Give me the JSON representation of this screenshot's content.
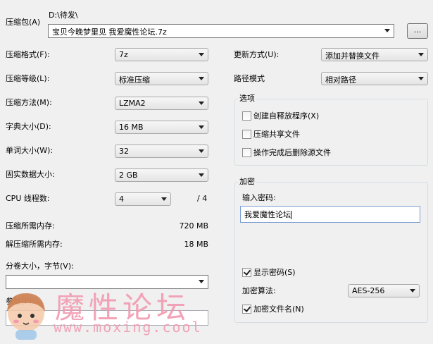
{
  "archive": {
    "label": "压缩包(A)",
    "path": "D:\\待发\\",
    "filename": "宝贝今晚梦里见 我爱魔性论坛.7z",
    "browse_label": "..."
  },
  "left": {
    "format": {
      "label": "压缩格式(F):",
      "value": "7z"
    },
    "level": {
      "label": "压缩等级(L):",
      "value": "标准压缩"
    },
    "method": {
      "label": "压缩方法(M):",
      "value": "LZMA2"
    },
    "dict": {
      "label": "字典大小(D):",
      "value": "16 MB"
    },
    "word": {
      "label": "单词大小(W):",
      "value": "32"
    },
    "solid": {
      "label": "固实数据大小:",
      "value": "2 GB"
    },
    "threads": {
      "label": "CPU 线程数:",
      "value": "4",
      "max": "/ 4"
    },
    "mem_compress": {
      "label": "压缩所需内存:",
      "value": "720 MB"
    },
    "mem_decompress": {
      "label": "解压缩所需内存:",
      "value": "18 MB"
    },
    "split": {
      "label": "分卷大小，字节(V):",
      "value": ""
    },
    "params": {
      "label": "参数(P):",
      "value": ""
    }
  },
  "right": {
    "update": {
      "label": "更新方式(U):",
      "value": "添加并替换文件"
    },
    "pathmode": {
      "label": "路径模式",
      "value": "相对路径"
    },
    "options": {
      "title": "选项",
      "sfx": {
        "label": "创建自释放程序(X)",
        "checked": false
      },
      "shared": {
        "label": "压缩共享文件",
        "checked": false
      },
      "delete": {
        "label": "操作完成后删除源文件",
        "checked": false
      }
    },
    "encryption": {
      "title": "加密",
      "password_label": "输入密码:",
      "password_value": "我爱魔性论坛",
      "show_password": {
        "label": "显示密码(S)",
        "checked": true
      },
      "method_label": "加密算法:",
      "method_value": "AES-256",
      "encrypt_names": {
        "label": "加密文件名(N)",
        "checked": true
      }
    }
  },
  "watermark": {
    "title": "魔性论坛",
    "url": "www.moxing.cool"
  }
}
